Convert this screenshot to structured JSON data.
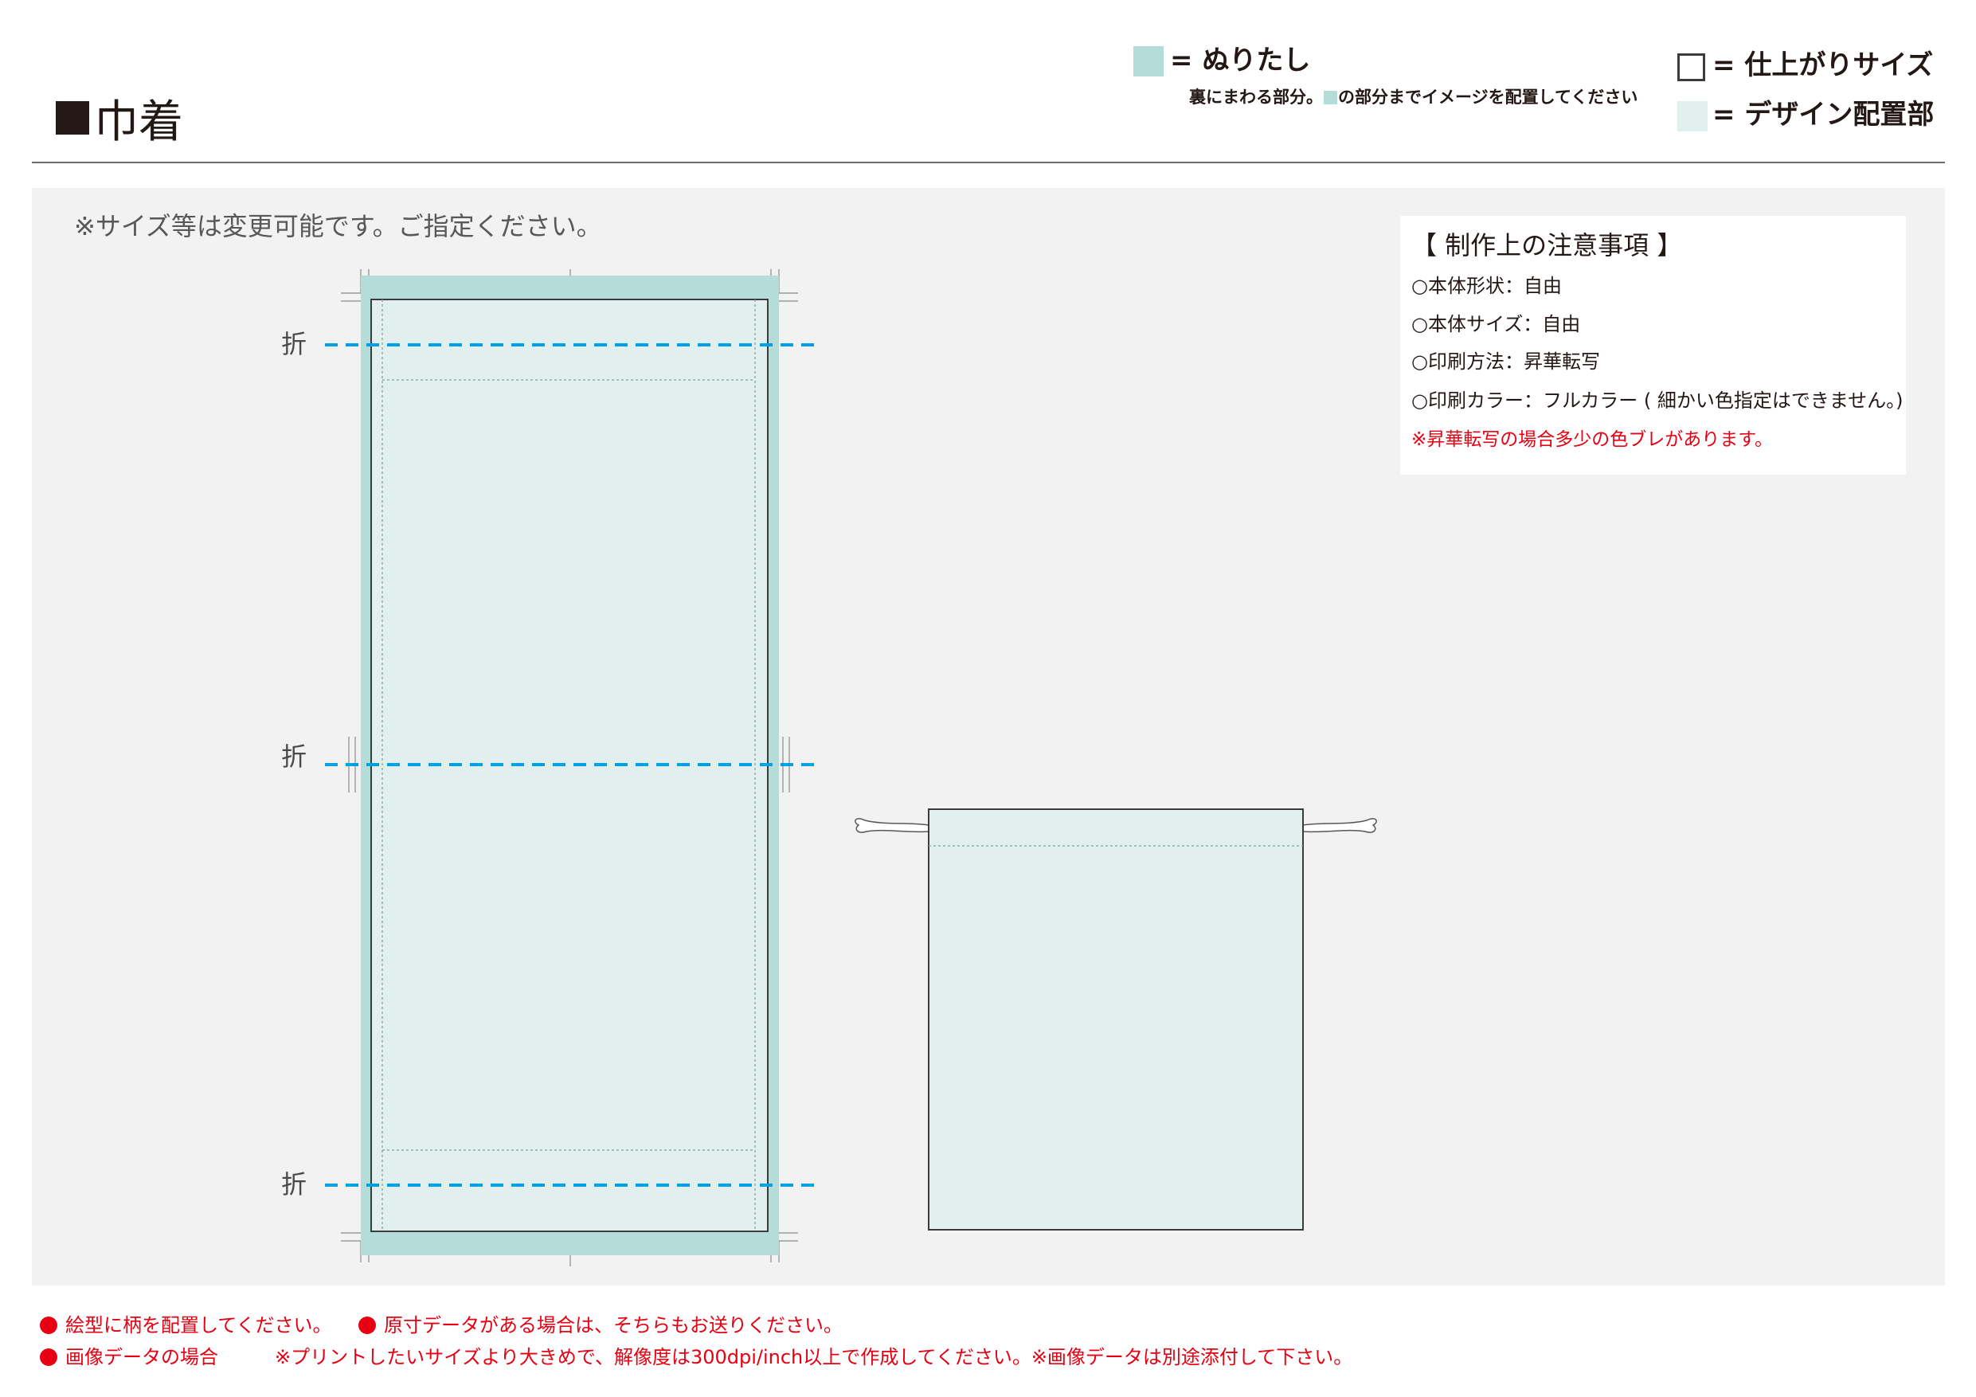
{
  "header": {
    "title": "巾着",
    "legend": [
      {
        "label": "= ぬりたし",
        "note_before": "裏にまわる部分。",
        "note_after": "の部分までイメージを配置してください",
        "color": "#b4dcd9"
      },
      {
        "label": "= 仕上がりサイズ",
        "color": "#ffffff"
      },
      {
        "label": "= デザイン配置部",
        "color": "#e1f0ee"
      }
    ]
  },
  "main": {
    "size_note": "※サイズ等は変更可能です。ご指定ください。",
    "fold_labels": [
      "折",
      "折",
      "折"
    ]
  },
  "notes": {
    "title": "【 制作上の注意事項 】",
    "lines": [
      "○本体形状：自由",
      "○本体サイズ：自由",
      "○印刷方法：昇華転写",
      "○印刷カラー：フルカラー ( 細かい色指定はできません。)"
    ],
    "warning": "※昇華転写の場合多少の色ブレがあります。"
  },
  "footer": {
    "line1_a": "絵型に柄を配置してください。",
    "line1_b": "原寸データがある場合は、そちらもお送りください。",
    "line2_a": "画像データの場合",
    "line2_b": "※プリントしたいサイズより大きめで、解像度は300dpi/inch以上で作成してください。※画像データは別途添付して下さい。"
  },
  "colors": {
    "bleed": "#b4dcd9",
    "design_area": "#e1f0ee",
    "fold_line": "#00a0e9",
    "warning": "#e60012"
  }
}
